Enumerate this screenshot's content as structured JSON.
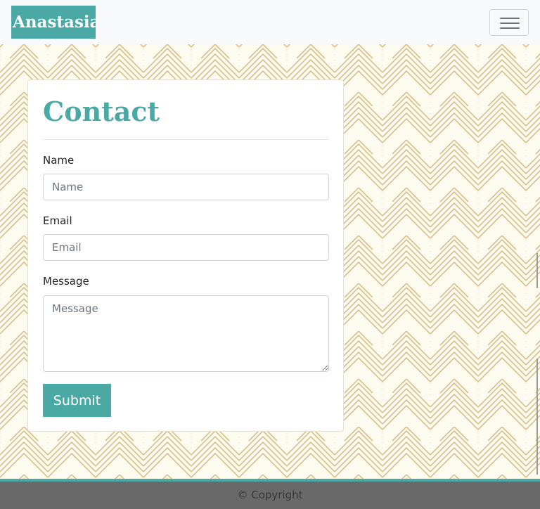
{
  "navbar": {
    "brand": "Anastasia I",
    "toggler_icon": "hamburger-menu-icon"
  },
  "contact": {
    "title": "Contact",
    "name_label": "Name",
    "name_placeholder": "Name",
    "email_label": "Email",
    "email_placeholder": "Email",
    "message_label": "Message",
    "message_placeholder": "Message",
    "submit_label": "Submit"
  },
  "footer": {
    "copyright": "© Copyright"
  },
  "colors": {
    "accent": "#4aa9a4",
    "pattern_line": "#d9c08a",
    "pattern_bg": "#fdfaf0",
    "navbar_bg": "#f8f9fa",
    "footer_bg": "#696969"
  }
}
